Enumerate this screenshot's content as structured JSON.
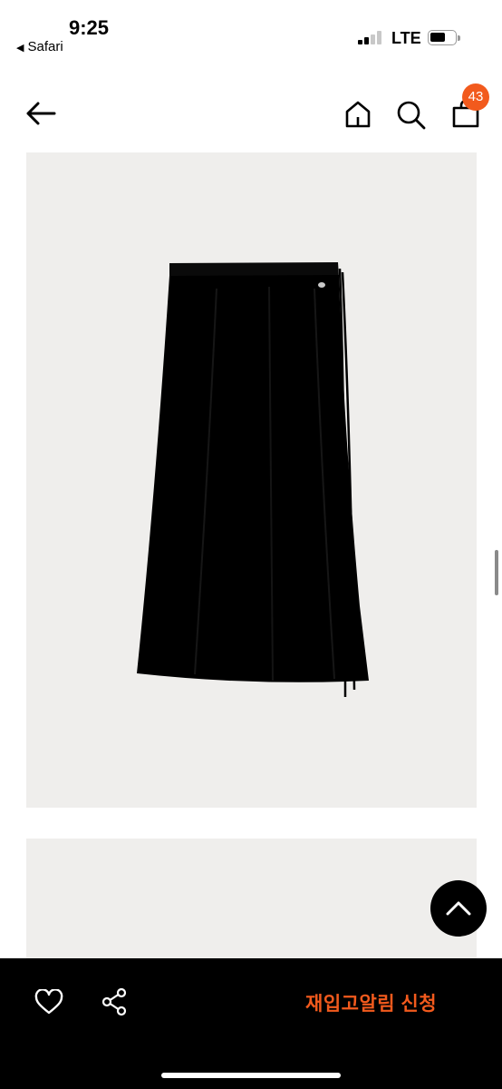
{
  "status_bar": {
    "time": "9:25",
    "back_app": "Safari",
    "network": "LTE"
  },
  "header": {
    "cart_count": "43"
  },
  "product": {
    "title": "",
    "colors": {
      "badge": "#f25a1d",
      "image_bg": "#efeeec",
      "garment": "#000000"
    }
  },
  "bottom_bar": {
    "restock_label": "재입고알림 신청"
  },
  "icons": [
    "back-arrow-icon",
    "home-icon",
    "search-icon",
    "cart-icon",
    "chevron-up-icon",
    "heart-icon",
    "share-icon"
  ]
}
